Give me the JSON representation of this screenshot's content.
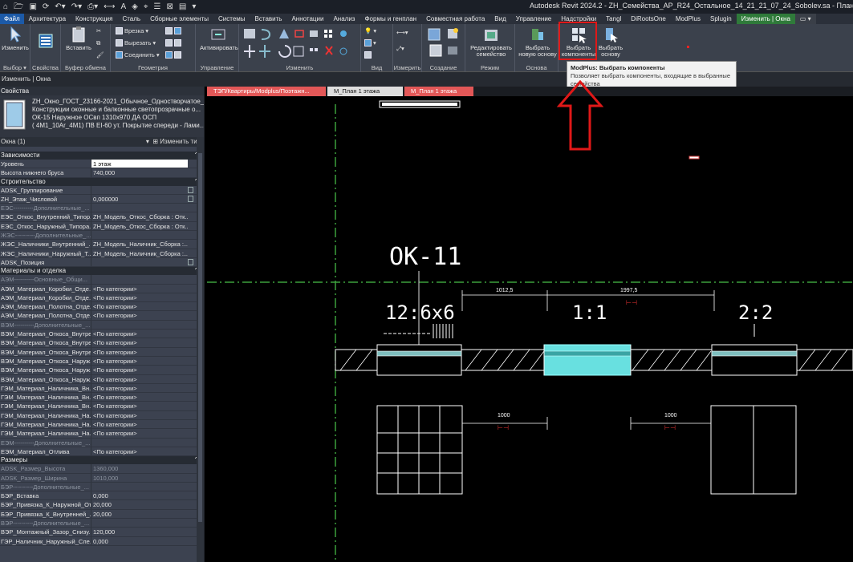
{
  "app": {
    "title": "Autodesk Revit 2024.2 - ZH_Семейства_АР_R24_Остальное_14_21_21_07_24_Sobolev.sa - План этажа: М_План 1 этажа"
  },
  "tabs": [
    {
      "label": "Файл",
      "kind": "file"
    },
    {
      "label": "Архитектура"
    },
    {
      "label": "Конструкция"
    },
    {
      "label": "Сталь"
    },
    {
      "label": "Сборные элементы"
    },
    {
      "label": "Системы"
    },
    {
      "label": "Вставить"
    },
    {
      "label": "Аннотации"
    },
    {
      "label": "Анализ"
    },
    {
      "label": "Формы и генплан"
    },
    {
      "label": "Совместная работа"
    },
    {
      "label": "Вид"
    },
    {
      "label": "Управление"
    },
    {
      "label": "Надстройки"
    },
    {
      "label": "Tangl"
    },
    {
      "label": "DiRootsOne"
    },
    {
      "label": "ModPlus"
    },
    {
      "label": "Splugin"
    },
    {
      "label": "Изменить | Окна",
      "kind": "active"
    },
    {
      "label": "▭ ▾",
      "kind": "extra"
    }
  ],
  "ribbon": {
    "groups": {
      "select": "Выбор ▾",
      "properties": "Свойства",
      "clipboard": "Буфер обмена",
      "geometry": "Геометрия",
      "manage": "Управление",
      "modify": "Изменить",
      "view": "Вид",
      "measure": "Измерить",
      "create": "Создание",
      "mode": "Режим",
      "host": "Основа"
    },
    "buttons": {
      "modify": "Изменить",
      "paste": "Вставить",
      "cope": "Врезка",
      "cut": "Вырезать",
      "join": "Соединить",
      "activate": "Активировать",
      "edit_family": "Редактировать семейство",
      "pick_new_host": "Выбрать новую основу",
      "select_components": "Выбрать компоненты",
      "pick_host": "Выбрать основу"
    }
  },
  "context_bar": "Изменить | Окна",
  "tooltip": {
    "title": "ModPlus: Выбрать компоненты",
    "text": "Позволяет выбрать компоненты, входящие в выбранные семейства"
  },
  "properties": {
    "header": "Свойства",
    "type_lines": [
      "ZH_Окно_ГОСТ_23166-2021_Обычное_Одностворчатое_1_",
      "Конструкции оконные и балконные светопрозрачные о...",
      "ОК-15 Наружное ОСвп 1310х970 ДА ОСП",
      "( 4М1_10Аr_4М1) ПВ ЕI-60 ут.  Покрытие спереди - Лами..."
    ],
    "selection": "Окна (1)",
    "edit_type": "Изменить тип",
    "categories": [
      {
        "name": "Зависимости",
        "rows": [
          {
            "k": "Уровень",
            "v": "1 этаж",
            "input": true
          },
          {
            "k": "Высота нижнего бруса",
            "v": "740,000"
          }
        ]
      },
      {
        "name": "Строительство",
        "rows": [
          {
            "k": "ADSK_Группирование",
            "v": "",
            "cb": true
          },
          {
            "k": "ZH_Этаж_Числовой",
            "v": "0,000000",
            "cb": true
          },
          {
            "k": "ЕЭС----------Дополнительные_...",
            "v": "",
            "dim": true
          },
          {
            "k": "ЕЭС_Откос_Внутренний_Типор...",
            "v": "ZH_Модель_Откос_Сборка : Отк..."
          },
          {
            "k": "ЕЭС_Откос_Наружный_Типора...",
            "v": "ZH_Модель_Откос_Сборка : Отк..."
          },
          {
            "k": "ЖЭС----------Дополнительные_...",
            "v": "",
            "dim": true
          },
          {
            "k": "ЖЭС_Наличники_Внутренний_...",
            "v": "ZH_Модель_Наличник_Сборка :..."
          },
          {
            "k": "ЖЭС_Наличники_Наружный_Т...",
            "v": "ZH_Модель_Наличник_Сборка :..."
          },
          {
            "k": "ADSK_Позиция",
            "v": "",
            "cb": true
          }
        ]
      },
      {
        "name": "Материалы и отделка",
        "rows": [
          {
            "k": "АЭМ----------Основные_Общи...",
            "v": "",
            "dim": true
          },
          {
            "k": "АЭМ_Материал_Коробки_Отде...",
            "v": "<По категории>"
          },
          {
            "k": "АЭМ_Материал_Коробки_Отде...",
            "v": "<По категории>"
          },
          {
            "k": "АЭМ_Материал_Полотна_Отде...",
            "v": "<По категории>"
          },
          {
            "k": "АЭМ_Материал_Полотна_Отде...",
            "v": "<По категории>"
          },
          {
            "k": "ВЭМ----------Дополнительные_...",
            "v": "",
            "dim": true
          },
          {
            "k": "ВЭМ_Материал_Откоса_Внутре...",
            "v": "<По категории>"
          },
          {
            "k": "ВЭМ_Материал_Откоса_Внутре...",
            "v": "<По категории>"
          },
          {
            "k": "ВЭМ_Материал_Откоса_Внутре...",
            "v": "<По категории>"
          },
          {
            "k": "ВЭМ_Материал_Откоса_Наруж...",
            "v": "<По категории>"
          },
          {
            "k": "ВЭМ_Материал_Откоса_Наруж...",
            "v": "<По категории>"
          },
          {
            "k": "ВЭМ_Материал_Откоса_Наруж...",
            "v": "<По категории>"
          },
          {
            "k": "ГЭМ_Материал_Наличника_Вн...",
            "v": "<По категории>"
          },
          {
            "k": "ГЭМ_Материал_Наличника_Вн...",
            "v": "<По категории>"
          },
          {
            "k": "ГЭМ_Материал_Наличника_Вн...",
            "v": "<По категории>"
          },
          {
            "k": "ГЭМ_Материал_Наличника_На...",
            "v": "<По категории>"
          },
          {
            "k": "ГЭМ_Материал_Наличника_На...",
            "v": "<По категории>"
          },
          {
            "k": "ГЭМ_Материал_Наличника_На...",
            "v": "<По категории>"
          },
          {
            "k": "ЕЭМ----------Дополнительные_...",
            "v": "",
            "dim": true
          },
          {
            "k": "ЕЭМ_Материал_Отлива",
            "v": "<По категории>"
          }
        ]
      },
      {
        "name": "Размеры",
        "rows": [
          {
            "k": "ADSK_Размер_Высота",
            "v": "1360,000",
            "dim": true
          },
          {
            "k": "ADSK_Размер_Ширина",
            "v": "1010,000",
            "dim": true
          },
          {
            "k": "БЭР----------Дополнительные_...",
            "v": "",
            "dim": true
          },
          {
            "k": "БЭР_Вставка",
            "v": "0,000"
          },
          {
            "k": "БЭР_Привязка_К_Наружной_От...",
            "v": "20,000"
          },
          {
            "k": "БЭР_Привязка_К_Внутренней_...",
            "v": "20,000"
          },
          {
            "k": "ВЭР----------Дополнительные_...",
            "v": "",
            "dim": true
          },
          {
            "k": "ВЭР_Монтажный_Зазор_Снизу...",
            "v": "120,000"
          },
          {
            "k": "ГЭР_Наличник_Наружный_Сле...",
            "v": "0,000"
          }
        ]
      }
    ]
  },
  "view_tabs": [
    {
      "label": "ТЭП/Квартиры/Modplus/Поэтажн...",
      "kind": "red"
    },
    {
      "label": "М_План 1 этажа",
      "kind": "white"
    },
    {
      "label": "М_План 1 этажа",
      "kind": "red"
    }
  ],
  "drawing": {
    "tag": "ОК-11",
    "labels": [
      "12:6x6",
      "1:1",
      "2:2"
    ],
    "dims": [
      "1012,5",
      "1997,5",
      "1000",
      "1000"
    ]
  },
  "colors": {
    "accent_green": "#2f7a3a",
    "file_blue": "#1c5aa8",
    "highlight_red": "#e01818",
    "selected_cyan": "#68e0e0"
  }
}
